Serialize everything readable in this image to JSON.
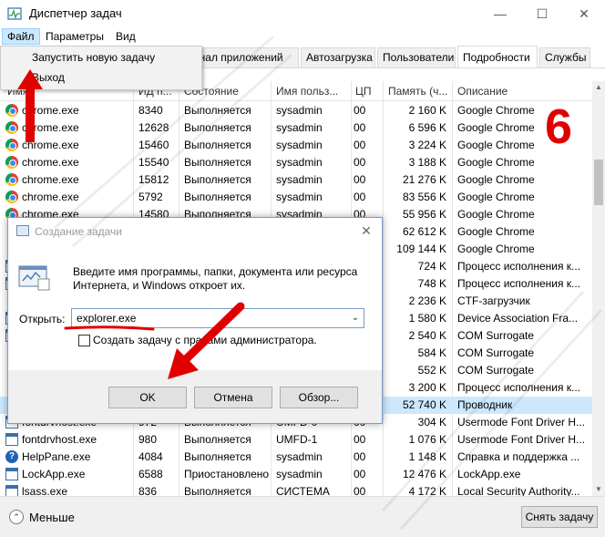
{
  "window": {
    "title": "Диспетчер задач",
    "minimize_icon": "—",
    "maximize_icon": "☐",
    "close_icon": "✕"
  },
  "menubar": {
    "file": "Файл",
    "options": "Параметры",
    "view": "Вид"
  },
  "file_menu": {
    "items": [
      "Запустить новую задачу",
      "Выход"
    ]
  },
  "tabs": [
    "рнал приложений",
    "Автозагрузка",
    "Пользователи",
    "Подробности",
    "Службы"
  ],
  "active_tab": "Подробности",
  "table": {
    "columns": [
      "Имя",
      "ИД п...",
      "Состояние",
      "Имя польз...",
      "ЦП",
      "Память (ч...",
      "Описание"
    ],
    "rows": [
      {
        "name": "chrome.exe",
        "pid": "8340",
        "state": "Выполняется",
        "user": "sysadmin",
        "cpu": "00",
        "mem": "2 160 K",
        "desc": "Google Chrome",
        "icon": "chrome-icon"
      },
      {
        "name": "chrome.exe",
        "pid": "12628",
        "state": "Выполняется",
        "user": "sysadmin",
        "cpu": "00",
        "mem": "6 596 K",
        "desc": "Google Chrome",
        "icon": "chrome-icon"
      },
      {
        "name": "chrome.exe",
        "pid": "15460",
        "state": "Выполняется",
        "user": "sysadmin",
        "cpu": "00",
        "mem": "3 224 K",
        "desc": "Google Chrome",
        "icon": "chrome-icon"
      },
      {
        "name": "chrome.exe",
        "pid": "15540",
        "state": "Выполняется",
        "user": "sysadmin",
        "cpu": "00",
        "mem": "3 188 K",
        "desc": "Google Chrome",
        "icon": "chrome-icon"
      },
      {
        "name": "chrome.exe",
        "pid": "15812",
        "state": "Выполняется",
        "user": "sysadmin",
        "cpu": "00",
        "mem": "21 276 K",
        "desc": "Google Chrome",
        "icon": "chrome-icon"
      },
      {
        "name": "chrome.exe",
        "pid": "5792",
        "state": "Выполняется",
        "user": "sysadmin",
        "cpu": "00",
        "mem": "83 556 K",
        "desc": "Google Chrome",
        "icon": "chrome-icon"
      },
      {
        "name": "chrome.exe",
        "pid": "14580",
        "state": "Выполняется",
        "user": "sysadmin",
        "cpu": "00",
        "mem": "55 956 K",
        "desc": "Google Chrome",
        "icon": "chrome-icon"
      },
      {
        "name": "",
        "pid": "",
        "state": "",
        "user": "",
        "cpu": "",
        "mem": "62 612 K",
        "desc": "Google Chrome",
        "icon": ""
      },
      {
        "name": "",
        "pid": "",
        "state": "",
        "user": "",
        "cpu": "",
        "mem": "109 144 K",
        "desc": "Google Chrome",
        "icon": ""
      },
      {
        "name": "",
        "pid": "",
        "state": "",
        "user": "",
        "cpu": "",
        "mem": "724 K",
        "desc": "Процесс исполнения к...",
        "icon": "window-icon"
      },
      {
        "name": "",
        "pid": "",
        "state": "",
        "user": "",
        "cpu": "",
        "mem": "748 K",
        "desc": "Процесс исполнения к...",
        "icon": "window-icon"
      },
      {
        "name": "",
        "pid": "",
        "state": "",
        "user": "",
        "cpu": "",
        "mem": "2 236 K",
        "desc": "CTF-загрузчик",
        "icon": ""
      },
      {
        "name": "",
        "pid": "",
        "state": "",
        "user": "",
        "cpu": "",
        "mem": "1 580 K",
        "desc": "Device Association Fra...",
        "icon": "window-icon"
      },
      {
        "name": "",
        "pid": "",
        "state": "",
        "user": "",
        "cpu": "",
        "mem": "2 540 K",
        "desc": "COM Surrogate",
        "icon": "window-icon"
      },
      {
        "name": "",
        "pid": "",
        "state": "",
        "user": "",
        "cpu": "",
        "mem": "584 K",
        "desc": "COM Surrogate",
        "icon": ""
      },
      {
        "name": "",
        "pid": "",
        "state": "",
        "user": "",
        "cpu": "",
        "mem": "552 K",
        "desc": "COM Surrogate",
        "icon": ""
      },
      {
        "name": "",
        "pid": "",
        "state": "",
        "user": "",
        "cpu": "",
        "mem": "3 200 K",
        "desc": "Процесс исполнения к...",
        "icon": ""
      },
      {
        "name": "",
        "pid": "",
        "state": "",
        "user": "",
        "cpu": "",
        "mem": "52 740 K",
        "desc": "Проводник",
        "icon": "",
        "highlight": true
      },
      {
        "name": "fontdrvhost.exe",
        "pid": "972",
        "state": "Выполняется",
        "user": "UMFD-0",
        "cpu": "00",
        "mem": "304 K",
        "desc": "Usermode Font Driver H...",
        "icon": "window-icon"
      },
      {
        "name": "fontdrvhost.exe",
        "pid": "980",
        "state": "Выполняется",
        "user": "UMFD-1",
        "cpu": "00",
        "mem": "1 076 K",
        "desc": "Usermode Font Driver H...",
        "icon": "window-icon"
      },
      {
        "name": "HelpPane.exe",
        "pid": "4084",
        "state": "Выполняется",
        "user": "sysadmin",
        "cpu": "00",
        "mem": "1 148 K",
        "desc": "Справка и поддержка ...",
        "icon": "help-icon"
      },
      {
        "name": "LockApp.exe",
        "pid": "6588",
        "state": "Приостановлено",
        "user": "sysadmin",
        "cpu": "00",
        "mem": "12 476 K",
        "desc": "LockApp.exe",
        "icon": "window-icon"
      },
      {
        "name": "lsass.exe",
        "pid": "836",
        "state": "Выполняется",
        "user": "СИСТЕМА",
        "cpu": "00",
        "mem": "4 172 K",
        "desc": "Local Security Authority...",
        "icon": "window-icon"
      }
    ]
  },
  "bottom": {
    "less_label": "Меньше",
    "less_icon": "⌃",
    "end_task": "Снять задачу"
  },
  "dialog": {
    "title": "Создание задачи",
    "close_icon": "✕",
    "description": "Введите имя программы, папки, документа или ресурса Интернета, и Windows откроет их.",
    "open_label": "Открыть:",
    "open_value": "explorer.exe",
    "dropdown_icon": "⌄",
    "admin_checkbox": "Создать задачу с правами администратора.",
    "ok": "OK",
    "cancel": "Отмена",
    "browse": "Обзор..."
  },
  "annotations": {
    "step_number": "6",
    "accent_color": "#e00000"
  },
  "colors": {
    "selection": "#cce8ff",
    "accent_red": "#e00000"
  }
}
